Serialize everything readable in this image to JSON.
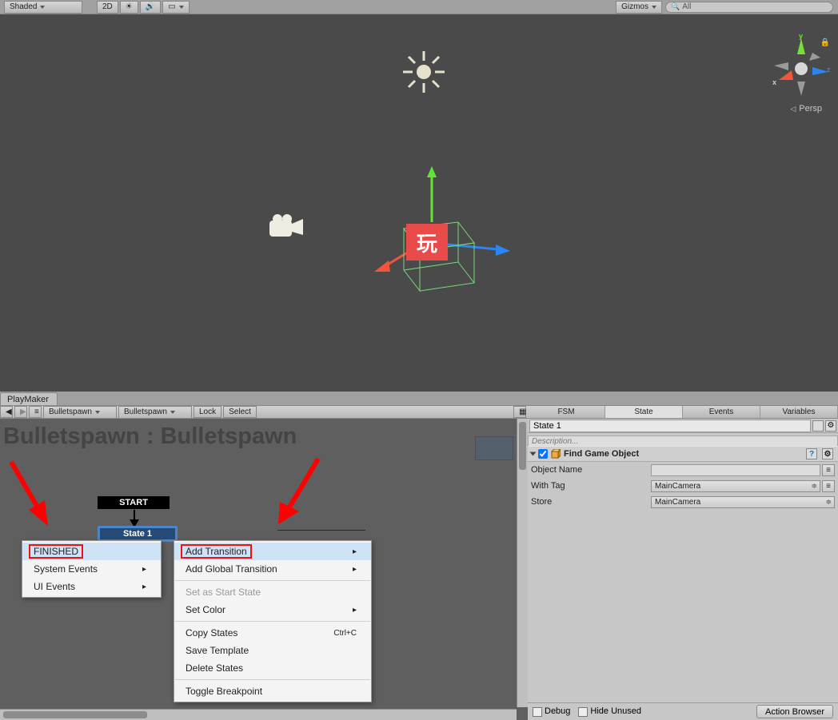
{
  "toolbar": {
    "shading_mode": "Shaded",
    "mode2d": "2D",
    "gizmos": "Gizmos",
    "search_placeholder": "All"
  },
  "scene": {
    "projection": "Persp",
    "axis": {
      "x": "x",
      "y": "y",
      "z": "z"
    },
    "watermark": "玩"
  },
  "playmaker": {
    "tab": "PlayMaker",
    "fsm_dropdown": "Bulletspawn",
    "state_dropdown": "Bulletspawn",
    "lock": "Lock",
    "select": "Select",
    "graph_title": "Bulletspawn : Bulletspawn",
    "start_label": "START",
    "state1_label": "State 1",
    "ctx1": {
      "finished": "FINISHED",
      "system_events": "System Events",
      "ui_events": "UI Events"
    },
    "ctx2": {
      "add_transition": "Add Transition",
      "add_global_transition": "Add Global Transition",
      "set_as_start_state": "Set as Start State",
      "set_color": "Set Color",
      "copy_states": "Copy States",
      "copy_shortcut": "Ctrl+C",
      "save_template": "Save Template",
      "delete_states": "Delete States",
      "toggle_breakpoint": "Toggle Breakpoint"
    }
  },
  "inspector": {
    "tabs": {
      "fsm": "FSM",
      "state": "State",
      "events": "Events",
      "variables": "Variables"
    },
    "state_name": "State 1",
    "description_placeholder": "Description...",
    "action_title": "Find Game Object",
    "props": {
      "object_name_label": "Object Name",
      "object_name_value": "",
      "with_tag_label": "With Tag",
      "with_tag_value": "MainCamera",
      "store_label": "Store",
      "store_value": "MainCamera"
    },
    "footer": {
      "debug": "Debug",
      "hide_unused": "Hide Unused",
      "action_browser": "Action Browser"
    }
  }
}
